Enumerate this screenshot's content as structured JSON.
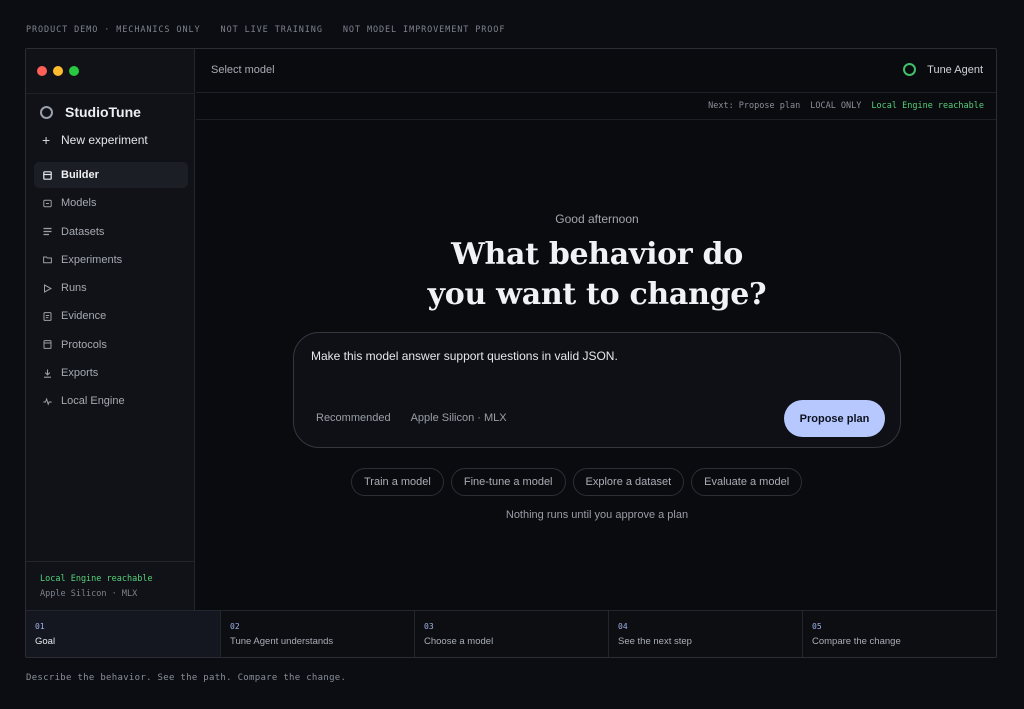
{
  "banner": {
    "items": [
      "PRODUCT DEMO · MECHANICS ONLY",
      "NOT LIVE TRAINING",
      "NOT MODEL IMPROVEMENT PROOF"
    ]
  },
  "sidebar": {
    "brand": "StudioTune",
    "new_experiment": "New experiment",
    "items": [
      {
        "label": "Builder",
        "icon": "builder-icon",
        "active": true
      },
      {
        "label": "Models",
        "icon": "models-icon"
      },
      {
        "label": "Datasets",
        "icon": "datasets-icon"
      },
      {
        "label": "Experiments",
        "icon": "folder-icon"
      },
      {
        "label": "Runs",
        "icon": "play-icon"
      },
      {
        "label": "Evidence",
        "icon": "evidence-icon"
      },
      {
        "label": "Protocols",
        "icon": "protocols-icon"
      },
      {
        "label": "Exports",
        "icon": "download-icon"
      },
      {
        "label": "Local Engine",
        "icon": "pulse-icon"
      }
    ],
    "footer": {
      "status": "Local Engine reachable",
      "detail": "Apple Silicon · MLX"
    }
  },
  "header": {
    "select_model": "Select model",
    "agent": "Tune Agent"
  },
  "statusbar": {
    "next": "Next: Propose plan",
    "mode": "LOCAL ONLY",
    "engine": "Local Engine reachable"
  },
  "main": {
    "greeting": "Good afternoon",
    "headline_line1": "What behavior do",
    "headline_line2": "you want to change?",
    "prompt_value": "Make this model answer support questions in valid JSON.",
    "recommended": "Recommended",
    "hardware": "Apple Silicon · MLX",
    "propose_button": "Propose plan",
    "chips": [
      "Train a model",
      "Fine-tune a model",
      "Explore a dataset",
      "Evaluate a model"
    ],
    "note": "Nothing runs until you approve a plan"
  },
  "steps": [
    {
      "num": "01",
      "label": "Goal",
      "active": true
    },
    {
      "num": "02",
      "label": "Tune Agent understands"
    },
    {
      "num": "03",
      "label": "Choose a model"
    },
    {
      "num": "04",
      "label": "See the next step"
    },
    {
      "num": "05",
      "label": "Compare the change"
    }
  ],
  "footer_note": "Describe the behavior. See the path. Compare the change.",
  "colors": {
    "accent_button": "#b7c8ff",
    "status_green": "#56d07a",
    "background": "#0b0d12"
  }
}
